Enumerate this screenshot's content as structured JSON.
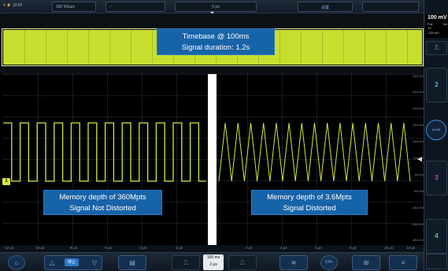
{
  "status": {
    "left": "4 ⚡ 10:55",
    "sample_rate": "300 MSa/s",
    "trigger_time": "0 ps",
    "settings_label": "设置",
    "trigger_marker": "▼"
  },
  "overview": {
    "timebase_line1": "Timebase @ 100ms",
    "timebase_line2": "Signal duration: 1.2s"
  },
  "callouts": {
    "left_line1": "Memory depth of 360Mpts",
    "left_line2": "Signal Not Distorted",
    "right_line1": "Memory depth of 3.6Mpts",
    "right_line2": "Signal Distorted"
  },
  "y_ticks": [
    "416 mV",
    "516 mV",
    "416 mV",
    "316 mV",
    "216 mV",
    "116 mV",
    "16 mV",
    "-84 mV",
    "-184 mV",
    "-284 mV",
    "-384 mV"
  ],
  "x_ticks": [
    "-12 μs",
    "-10 μs",
    "-8 μs",
    "-6 μs",
    "-4 μs",
    "-2 μs",
    "2 μs",
    "4 μs",
    "6 μs",
    "8 μs",
    "10 μs",
    "12 μs"
  ],
  "channel_marker": "1",
  "trigger_arrow": "◄",
  "toolbar": {
    "home_icon": "⌂",
    "up_icon": "△",
    "stop_label": "停止",
    "down_icon": "▽",
    "save_icon": "▤",
    "pulse_left_icon": "⎍",
    "time_top": "100 ms",
    "time_bottom": "2 μs",
    "pulse_right_icon": "⎍",
    "math_icon": "≋",
    "cursor_label": "CH+",
    "grid_icon": "⊞",
    "menu_icon": "≡"
  },
  "right_panel": {
    "volts": "100 mV",
    "full": "Full",
    "impedance": "1M",
    "probe": "1X",
    "offset": "-116 mV",
    "pulse_icon": "⎍",
    "ch2": "2",
    "level_label": "Level",
    "ch3": "3",
    "ch4": "4"
  },
  "colors": {
    "ch1": "#d5e837",
    "ch2": "#3ec8e8",
    "ch3": "#e040c8",
    "ch4": "#5fd45f",
    "callout": "#1763a8"
  }
}
